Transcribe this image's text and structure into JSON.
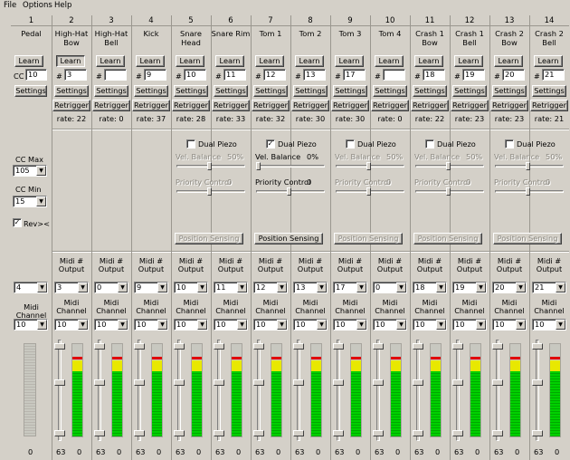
{
  "menu": [
    "File",
    "Options",
    "Help"
  ],
  "labels": {
    "learn": "Learn",
    "settings": "Settings",
    "retrigger": "Retrigger",
    "dual_piezo": "Dual Piezo",
    "vel_balance": "Vel. Balance",
    "priority": "Priority Control",
    "position": "Position Sensing",
    "midi_output": "Midi # Output",
    "midi_channel": "Midi Channel",
    "cc": "CC",
    "hash": "#",
    "rate": "rate:"
  },
  "pedal": {
    "num": "1",
    "name": "Pedal",
    "cc_value": "10",
    "cc_max_label": "CC Max",
    "cc_max": "105",
    "cc_min_label": "CC Min",
    "cc_min": "15",
    "rev_label": "Rev><",
    "rev_checked": true,
    "output": "4",
    "channel": "10",
    "value": "0"
  },
  "colors": {
    "green": "#00d000",
    "yellow": "#e8e800",
    "red": "#e00000",
    "bg": "#d4d0c8"
  },
  "pads": [
    {
      "name": "Tom 1",
      "piezo": false,
      "enabled": false,
      "vel": "50%",
      "pri": "0"
    },
    {
      "name": "Snare",
      "piezo": true,
      "enabled": true,
      "vel": "0%",
      "pri": "0"
    },
    {
      "name": "Tom 3",
      "piezo": false,
      "enabled": false,
      "vel": "50%",
      "pri": "0"
    },
    {
      "name": "Crash 1",
      "piezo": false,
      "enabled": false,
      "vel": "50%",
      "pri": "0"
    },
    {
      "name": "Crash 2",
      "piezo": false,
      "enabled": false,
      "vel": "50%",
      "pri": "0"
    }
  ],
  "channels": [
    {
      "num": "2",
      "name": "High-Hat\nBow",
      "note": "3",
      "rate": "22",
      "out": "3",
      "ch": "10",
      "left": "63",
      "right": "0",
      "learn_pressed": true
    },
    {
      "num": "3",
      "name": "High-Hat\nBell",
      "note": "",
      "rate": "0",
      "out": "0",
      "ch": "10",
      "left": "63",
      "right": "0",
      "learn_pressed": false
    },
    {
      "num": "4",
      "name": "Kick",
      "note": "9",
      "rate": "37",
      "out": "9",
      "ch": "10",
      "left": "63",
      "right": "0",
      "learn_pressed": false
    },
    {
      "num": "5",
      "name": "Snare\nHead",
      "note": "10",
      "rate": "28",
      "out": "10",
      "ch": "10",
      "left": "63",
      "right": "0",
      "learn_pressed": false
    },
    {
      "num": "6",
      "name": "Snare Rim",
      "note": "11",
      "rate": "33",
      "out": "11",
      "ch": "10",
      "left": "63",
      "right": "0",
      "learn_pressed": false
    },
    {
      "num": "7",
      "name": "Tom 1",
      "note": "12",
      "rate": "32",
      "out": "12",
      "ch": "10",
      "left": "63",
      "right": "0",
      "learn_pressed": false
    },
    {
      "num": "8",
      "name": "Tom 2",
      "note": "13",
      "rate": "30",
      "out": "13",
      "ch": "10",
      "left": "63",
      "right": "0",
      "learn_pressed": false
    },
    {
      "num": "9",
      "name": "Tom 3",
      "note": "17",
      "rate": "30",
      "out": "17",
      "ch": "10",
      "left": "63",
      "right": "0",
      "learn_pressed": false
    },
    {
      "num": "10",
      "name": "Tom 4",
      "note": "",
      "rate": "0",
      "out": "0",
      "ch": "10",
      "left": "63",
      "right": "0",
      "learn_pressed": false
    },
    {
      "num": "11",
      "name": "Crash 1\nBow",
      "note": "18",
      "rate": "22",
      "out": "18",
      "ch": "10",
      "left": "63",
      "right": "0",
      "learn_pressed": false
    },
    {
      "num": "12",
      "name": "Crash 1\nBell",
      "note": "19",
      "rate": "23",
      "out": "19",
      "ch": "10",
      "left": "63",
      "right": "0",
      "learn_pressed": false
    },
    {
      "num": "13",
      "name": "Crash 2\nBow",
      "note": "20",
      "rate": "23",
      "out": "20",
      "ch": "10",
      "left": "63",
      "right": "0",
      "learn_pressed": false
    },
    {
      "num": "14",
      "name": "Crash 2\nBell",
      "note": "21",
      "rate": "21",
      "out": "21",
      "ch": "10",
      "left": "63",
      "right": "0",
      "learn_pressed": false
    }
  ]
}
